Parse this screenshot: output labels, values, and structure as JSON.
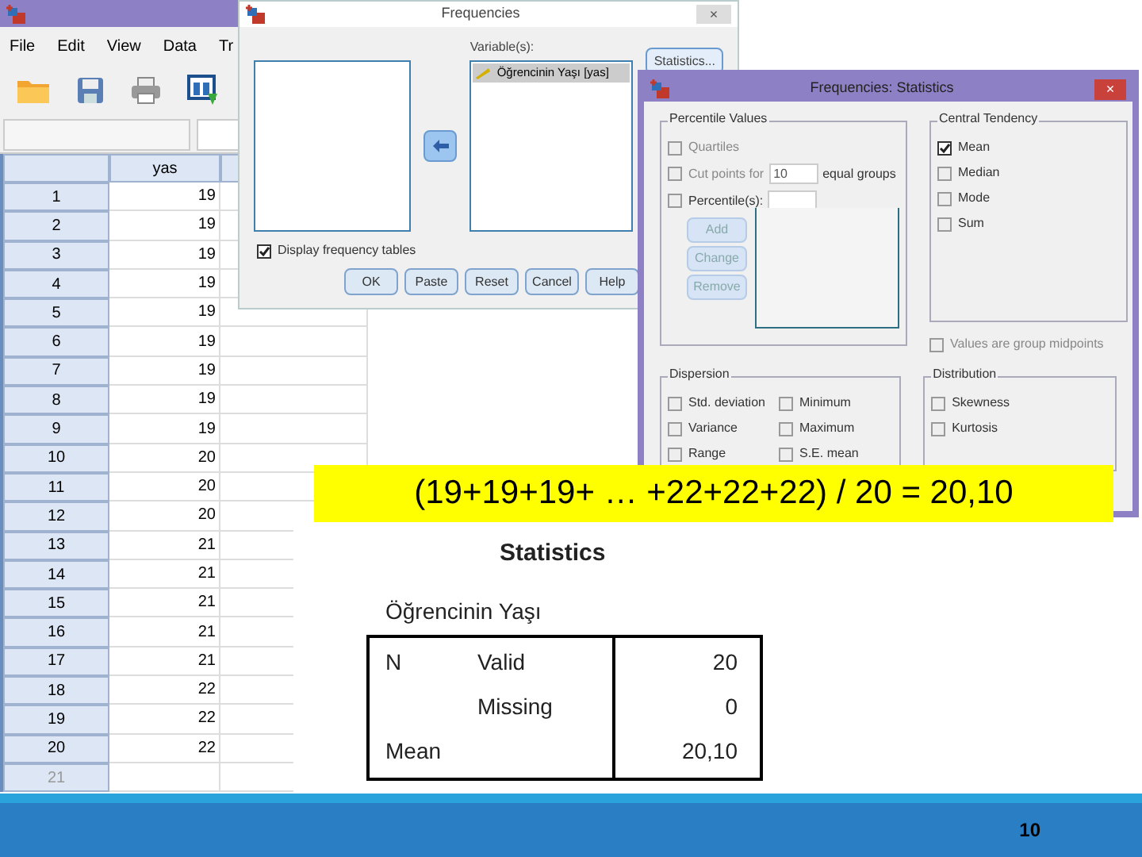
{
  "data_editor": {
    "menu": [
      "File",
      "Edit",
      "View",
      "Data",
      "Tr"
    ],
    "column_header": "yas",
    "rows": [
      {
        "row": "1",
        "yas": "19"
      },
      {
        "row": "2",
        "yas": "19"
      },
      {
        "row": "3",
        "yas": "19"
      },
      {
        "row": "4",
        "yas": "19"
      },
      {
        "row": "5",
        "yas": "19"
      },
      {
        "row": "6",
        "yas": "19"
      },
      {
        "row": "7",
        "yas": "19"
      },
      {
        "row": "8",
        "yas": "19"
      },
      {
        "row": "9",
        "yas": "19"
      },
      {
        "row": "10",
        "yas": "20"
      },
      {
        "row": "11",
        "yas": "20"
      },
      {
        "row": "12",
        "yas": "20"
      },
      {
        "row": "13",
        "yas": "21"
      },
      {
        "row": "14",
        "yas": "21"
      },
      {
        "row": "15",
        "yas": "21"
      },
      {
        "row": "16",
        "yas": "21"
      },
      {
        "row": "17",
        "yas": "21"
      },
      {
        "row": "18",
        "yas": "22"
      },
      {
        "row": "19",
        "yas": "22"
      },
      {
        "row": "20",
        "yas": "22"
      },
      {
        "row": "21"
      }
    ]
  },
  "frequencies_dialog": {
    "title": "Frequencies",
    "close": "×",
    "variables_label": "Variable(s):",
    "variables": [
      "Öğrencinin Yaşı [yas]"
    ],
    "statistics_button": "Statistics...",
    "display_frequency_tables": {
      "label": "Display frequency tables",
      "checked": true
    },
    "buttons": [
      "OK",
      "Paste",
      "Reset",
      "Cancel",
      "Help"
    ]
  },
  "statistics_dialog": {
    "title": "Frequencies: Statistics",
    "close": "×",
    "percentile_values": {
      "title": "Percentile Values",
      "quartiles": {
        "label": "Quartiles",
        "checked": false
      },
      "cut_points": {
        "label": "Cut points for",
        "value": "10",
        "suffix": "equal groups",
        "checked": false
      },
      "percentiles": {
        "label": "Percentile(s):",
        "checked": false
      },
      "buttons": [
        {
          "label": "Add",
          "disabled": true
        },
        {
          "label": "Change",
          "disabled": true
        },
        {
          "label": "Remove",
          "disabled": true
        }
      ]
    },
    "central_tendency": {
      "title": "Central Tendency",
      "options": [
        {
          "label": "Mean",
          "checked": true
        },
        {
          "label": "Median",
          "checked": false
        },
        {
          "label": "Mode",
          "checked": false
        },
        {
          "label": "Sum",
          "checked": false
        }
      ]
    },
    "group_midpoints": {
      "label": "Values are group midpoints",
      "checked": false
    },
    "dispersion": {
      "title": "Dispersion",
      "options": [
        {
          "label": "Std. deviation",
          "checked": false
        },
        {
          "label": "Minimum",
          "checked": false
        },
        {
          "label": "Variance",
          "checked": false
        },
        {
          "label": "Maximum",
          "checked": false
        },
        {
          "label": "Range",
          "checked": false
        },
        {
          "label": "S.E. mean",
          "checked": false
        }
      ]
    },
    "distribution": {
      "title": "Distribution",
      "options": [
        {
          "label": "Skewness",
          "checked": false
        },
        {
          "label": "Kurtosis",
          "checked": false
        }
      ]
    }
  },
  "banner": "(19+19+19+ … +22+22+22) / 20 = 20,10",
  "output": {
    "title": "Statistics",
    "subtitle": "Öğrencinin Yaşı",
    "rows": [
      {
        "label": "N",
        "sublabel": "Valid",
        "value": "20"
      },
      {
        "sublabel": "Missing",
        "value": "0"
      },
      {
        "label": "Mean",
        "value": "20,10"
      }
    ]
  },
  "page_number": "10"
}
